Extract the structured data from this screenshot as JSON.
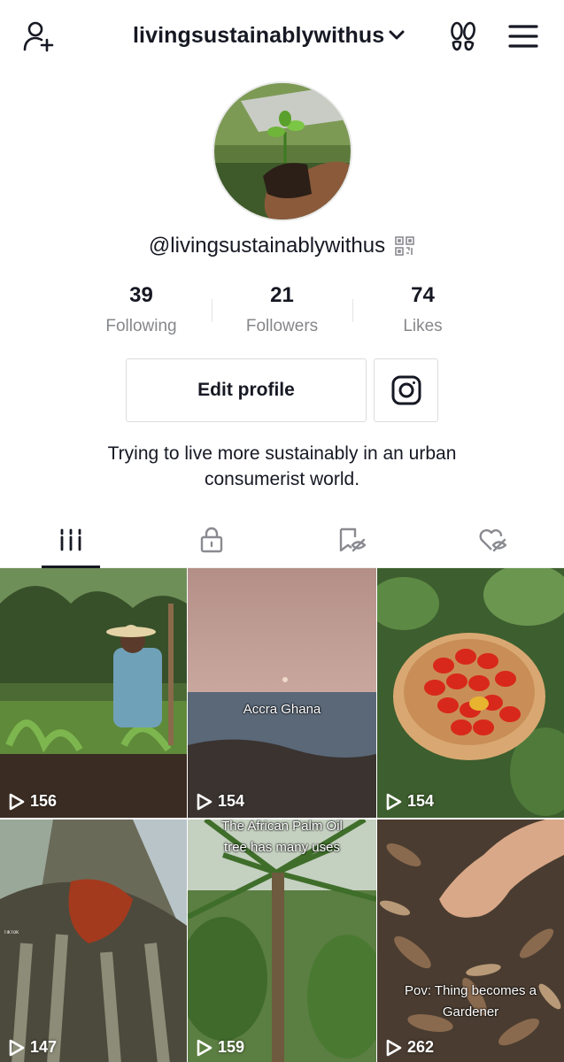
{
  "header": {
    "username": "livingsustainablywithus",
    "icons": [
      "add-user-icon",
      "chevron-down-icon",
      "footprint-icon",
      "hamburger-menu-icon"
    ]
  },
  "profile": {
    "handle": "@livingsustainablywithus",
    "stats": [
      {
        "value": "39",
        "label": "Following"
      },
      {
        "value": "21",
        "label": "Followers"
      },
      {
        "value": "74",
        "label": "Likes"
      }
    ],
    "edit_label": "Edit profile",
    "bio_line1": "Trying to live more sustainably in an urban",
    "bio_line2": "consumerist world."
  },
  "tabs": [
    "videos-grid-icon",
    "private-lock-icon",
    "bookmark-hidden-icon",
    "liked-hidden-icon"
  ],
  "videos": [
    {
      "views": "156",
      "caption": ""
    },
    {
      "views": "154",
      "caption": "Accra Ghana"
    },
    {
      "views": "154",
      "caption": ""
    },
    {
      "views": "147",
      "caption": "",
      "watermark": "TikTok"
    },
    {
      "views": "159",
      "caption_line1": "The African Palm Oil",
      "caption_line2": "tree has many uses"
    },
    {
      "views": "262",
      "caption_line1": "Pov: Thing becomes a",
      "caption_line2": "Gardener"
    }
  ],
  "colors": {
    "text": "#161823",
    "muted": "#86878b",
    "border": "#dcdcde"
  }
}
